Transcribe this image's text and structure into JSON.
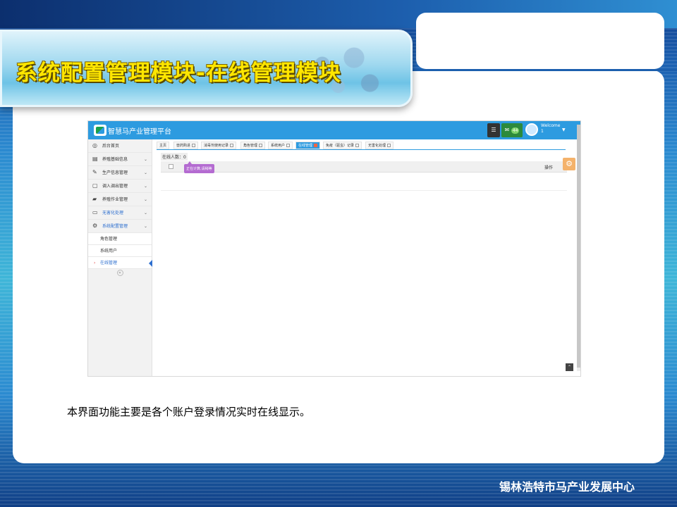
{
  "slide": {
    "title": "系统配置管理模块-在线管理模块",
    "description": "本界面功能主要是各个账户登录情况实时在线显示。",
    "footer": "锡林浩特市马产业发展中心"
  },
  "app": {
    "title": "智慧马产业管理平台",
    "header": {
      "mail_badge": "44",
      "welcome": "Welcome",
      "user": "1"
    },
    "sidebar": {
      "items": [
        {
          "label": "后台首页",
          "icon": "dashboard-icon"
        },
        {
          "label": "养殖基础信息",
          "icon": "table-icon"
        },
        {
          "label": "生产信息管理",
          "icon": "edit-icon"
        },
        {
          "label": "调入调出管理",
          "icon": "file-icon"
        },
        {
          "label": "养殖作业管理",
          "icon": "folder-icon"
        },
        {
          "label": "无害化处理",
          "icon": "desktop-icon"
        },
        {
          "label": "系统配置管理",
          "icon": "cogs-icon"
        }
      ],
      "subitems": [
        {
          "label": "角色管理"
        },
        {
          "label": "系统用户"
        },
        {
          "label": "在线管理"
        }
      ],
      "collapse_icon": "double-chevron-left-icon"
    },
    "tabs": [
      {
        "label": "主页"
      },
      {
        "label": "兽药购进"
      },
      {
        "label": "消毒剂使用记录"
      },
      {
        "label": "角色管理"
      },
      {
        "label": "系统用户"
      },
      {
        "label": "在线管理"
      },
      {
        "label": "免疫（驱虫）记录"
      },
      {
        "label": "无害化处理"
      }
    ],
    "online_count": "在线人数：0",
    "table": {
      "operation_header": "操作"
    },
    "loading_tooltip": "正在计算,请稍等",
    "colors": {
      "header": "#2d9be0",
      "accent": "#2d6fcf"
    }
  }
}
